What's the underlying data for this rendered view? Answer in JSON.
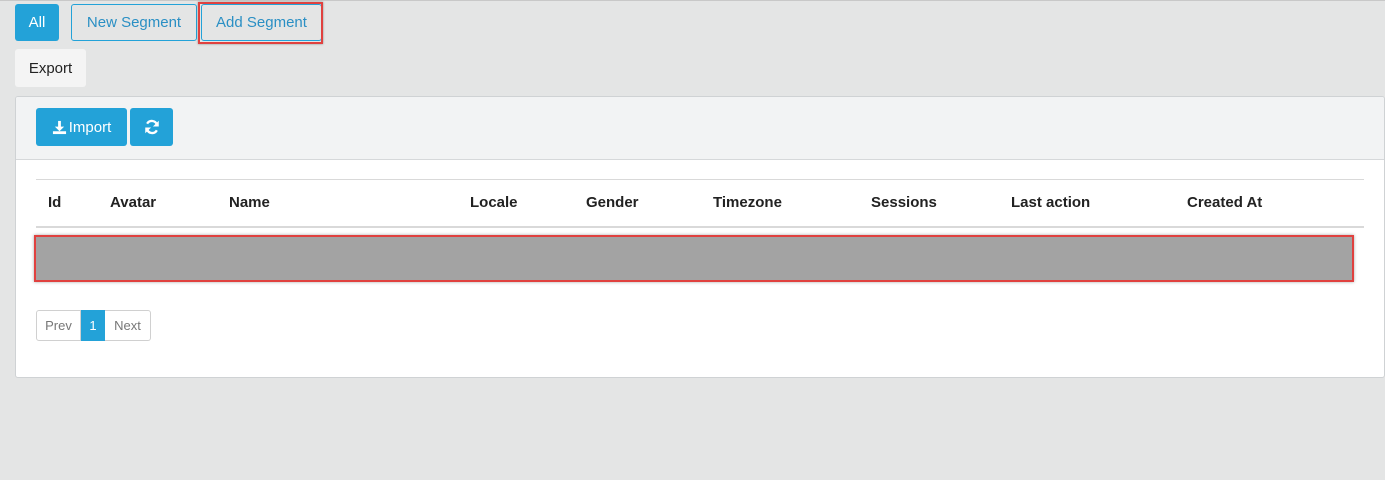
{
  "segments": {
    "all_label": "All",
    "new_segment_label": "New Segment",
    "add_segment_label": "Add Segment"
  },
  "toolbar": {
    "export_label": "Export",
    "import_label": "Import",
    "import_icon": "download-icon",
    "refresh_icon": "refresh-icon"
  },
  "table": {
    "columns": [
      "Id",
      "Avatar",
      "Name",
      "Locale",
      "Gender",
      "Timezone",
      "Sessions",
      "Last action",
      "Created At"
    ]
  },
  "pagination": {
    "prev_label": "Prev",
    "current_page": "1",
    "next_label": "Next"
  },
  "colors": {
    "accent": "#23a2d8",
    "highlight": "#e0413f",
    "row_placeholder": "#a3a3a3",
    "background": "#e4e5e5"
  }
}
